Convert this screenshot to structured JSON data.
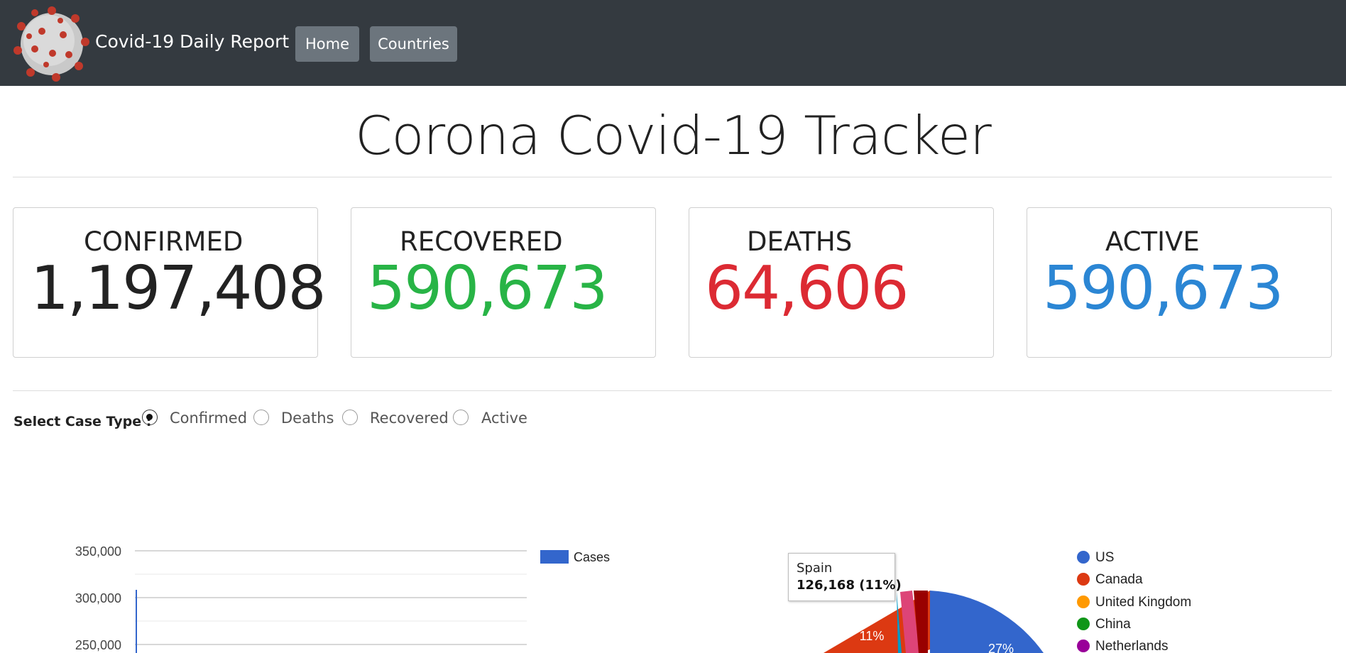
{
  "navbar": {
    "brand": "Covid-19 Daily Report",
    "links": [
      "Home",
      "Countries"
    ]
  },
  "page_title": "Corona Covid-19 Tracker",
  "stats": {
    "confirmed": {
      "label": "CONFIRMED",
      "value": "1,197,408",
      "color": "#222222"
    },
    "recovered": {
      "label": "RECOVERED",
      "value": "590,673",
      "color": "#28b446"
    },
    "deaths": {
      "label": "DEATHS",
      "value": "64,606",
      "color": "#dc2a33"
    },
    "active": {
      "label": "ACTIVE",
      "value": "590,673",
      "color": "#2b86d4"
    }
  },
  "case_type": {
    "label": "Select Case Type :",
    "options": [
      "Confirmed",
      "Deaths",
      "Recovered",
      "Active"
    ],
    "selected": "Confirmed"
  },
  "chart_data": [
    {
      "type": "bar",
      "title": "",
      "xlabel": "",
      "ylabel": "",
      "y_ticks_visible": [
        "350,000",
        "300,000",
        "250,000"
      ],
      "series": [
        {
          "name": "Cases",
          "color": "#3366cc"
        }
      ],
      "legend_position": "right",
      "grid": true
    },
    {
      "type": "pie",
      "title": "",
      "legend": [
        {
          "name": "US",
          "color": "#3366cc"
        },
        {
          "name": "Canada",
          "color": "#dc3912"
        },
        {
          "name": "United Kingdom",
          "color": "#ff9900"
        },
        {
          "name": "China",
          "color": "#109618"
        },
        {
          "name": "Netherlands",
          "color": "#990099"
        }
      ],
      "slice_labels": [
        "11%",
        "27%"
      ],
      "tooltip": {
        "name": "Spain",
        "value": "126,168 (11%)"
      },
      "legend_position": "right"
    }
  ]
}
